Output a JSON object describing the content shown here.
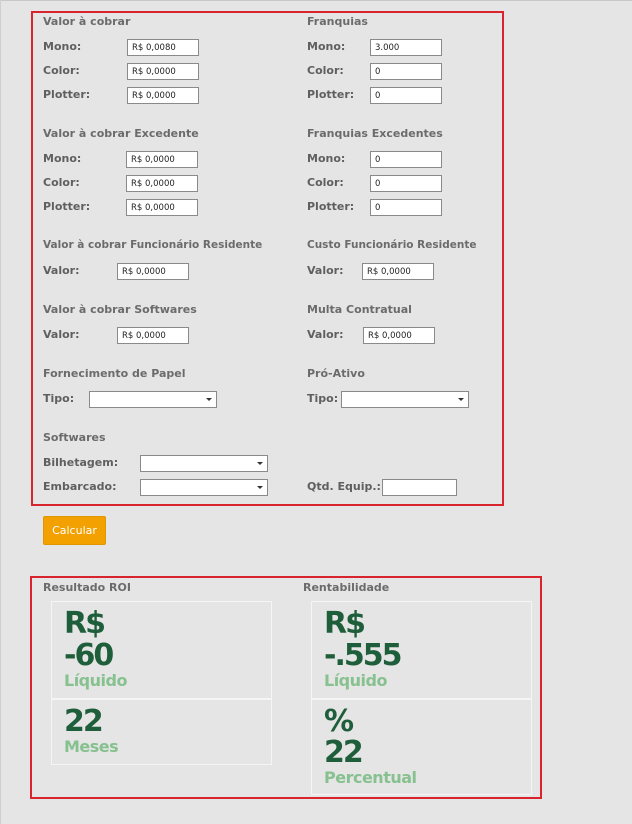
{
  "valor_cobrar": {
    "title": "Valor à cobrar",
    "rows": [
      {
        "label": "Mono:",
        "value": "R$ 0,0080"
      },
      {
        "label": "Color:",
        "value": "R$ 0,0000"
      },
      {
        "label": "Plotter:",
        "value": "R$ 0,0000"
      }
    ]
  },
  "franquias": {
    "title": "Franquias",
    "rows": [
      {
        "label": "Mono:",
        "value": "3.000"
      },
      {
        "label": "Color:",
        "value": "0"
      },
      {
        "label": "Plotter:",
        "value": "0"
      }
    ]
  },
  "valor_excedente": {
    "title": "Valor à cobrar Excedente",
    "rows": [
      {
        "label": "Mono:",
        "value": "R$ 0,0000"
      },
      {
        "label": "Color:",
        "value": "R$ 0,0000"
      },
      {
        "label": "Plotter:",
        "value": "R$ 0,0000"
      }
    ]
  },
  "franquias_excedentes": {
    "title": "Franquias Excedentes",
    "rows": [
      {
        "label": "Mono:",
        "value": "0"
      },
      {
        "label": "Color:",
        "value": "0"
      },
      {
        "label": "Plotter:",
        "value": "0"
      }
    ]
  },
  "funcionario_residente": {
    "title": "Valor à cobrar Funcionário Residente",
    "label": "Valor:",
    "value": "R$ 0,0000"
  },
  "custo_funcionario": {
    "title": "Custo Funcionário Residente",
    "label": "Valor:",
    "value": "R$ 0,0000"
  },
  "softwares_valor": {
    "title": "Valor à cobrar Softwares",
    "label": "Valor:",
    "value": "R$ 0,0000"
  },
  "multa": {
    "title": "Multa Contratual",
    "label": "Valor:",
    "value": "R$ 0,0000"
  },
  "papel": {
    "title": "Fornecimento de Papel",
    "label": "Tipo:",
    "selected": ""
  },
  "proativo": {
    "title": "Pró-Ativo",
    "label": "Tipo:",
    "selected": ""
  },
  "softwares": {
    "title": "Softwares",
    "bilhetagem_label": "Bilhetagem:",
    "bilhetagem_selected": "",
    "embarcado_label": "Embarcado:",
    "embarcado_selected": ""
  },
  "qtd_equip": {
    "label": "Qtd. Equip.:",
    "value": ""
  },
  "calcular_label": "Calcular",
  "resultado": {
    "title": "Resultado ROI",
    "liquido_currency": "R$",
    "liquido_value": "-60",
    "liquido_caption": "Líquido",
    "meses_value": "22",
    "meses_caption": "Meses"
  },
  "rentabilidade": {
    "title": "Rentabilidade",
    "liquido_currency": "R$",
    "liquido_value": "-.555",
    "liquido_caption": "Líquido",
    "percent_symbol": "%",
    "percent_value": "22",
    "percent_caption": "Percentual"
  },
  "colors": {
    "accent": "#f2a100",
    "border": "#d9232d",
    "dark_green": "#1f5e3a",
    "light_green": "#86c18f"
  }
}
